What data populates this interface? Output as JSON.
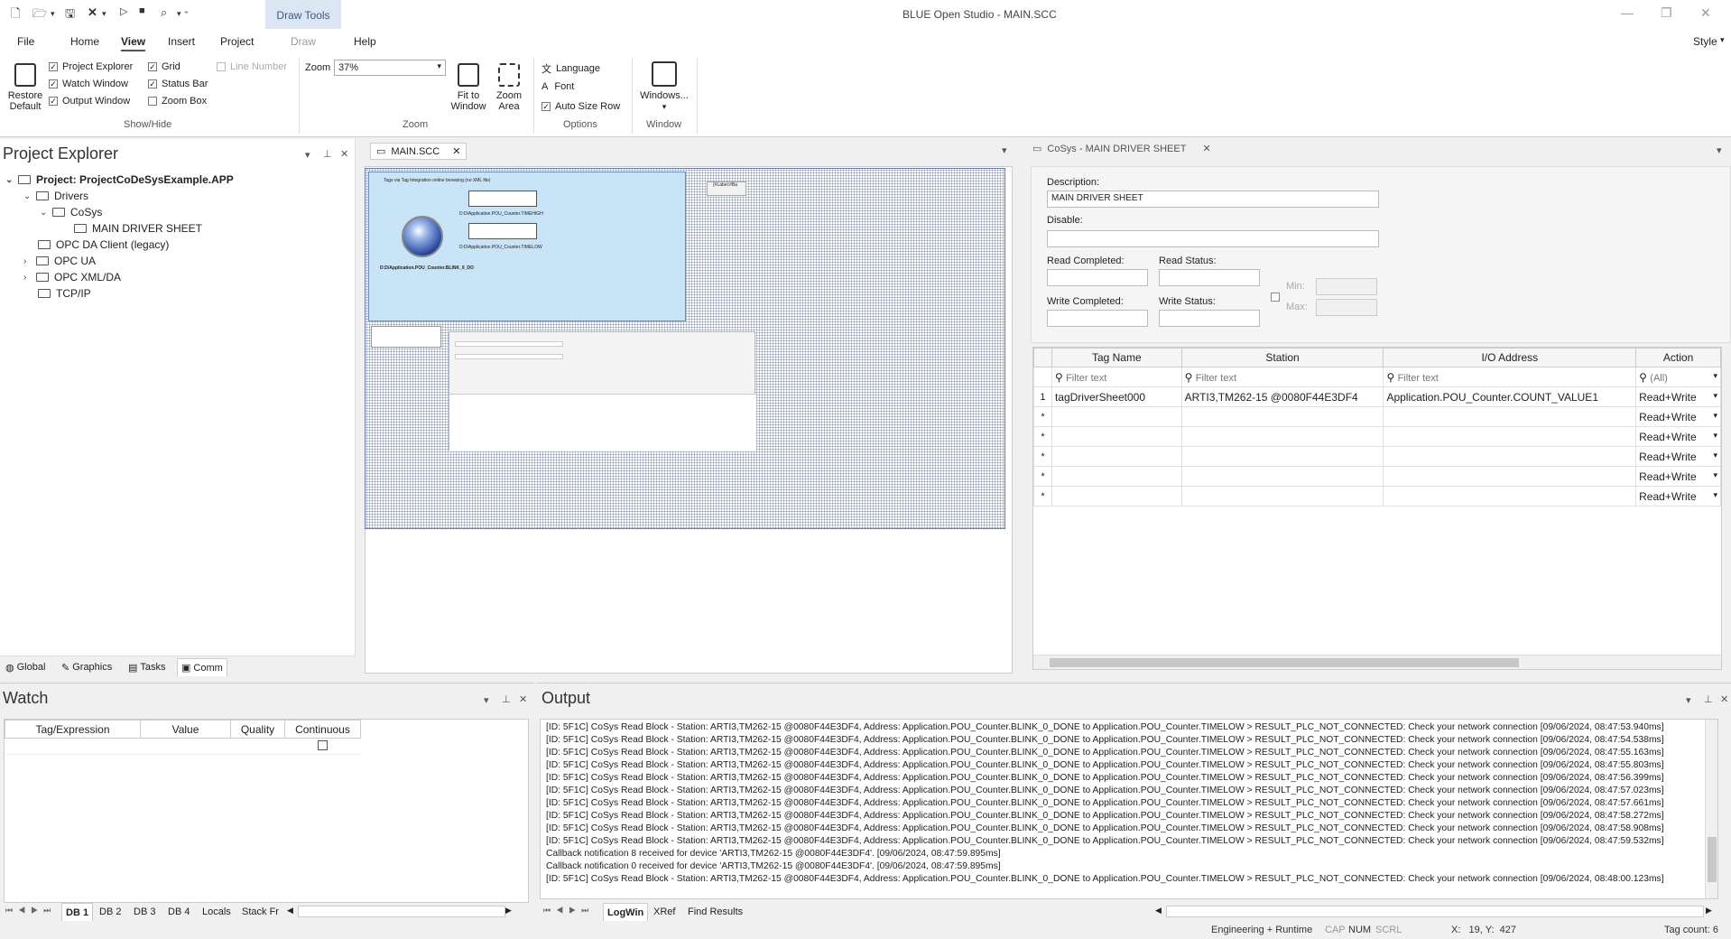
{
  "app": {
    "window_title": "BLUE Open Studio - MAIN.SCC",
    "context_tab": "Draw Tools"
  },
  "menu": {
    "items": [
      "File",
      "Home",
      "View",
      "Insert",
      "Project",
      "Draw",
      "Help"
    ],
    "style_label": "Style"
  },
  "ribbon": {
    "restore_default": "Restore Default",
    "restore_default_l1": "Restore",
    "restore_default_l2": "Default",
    "project_explorer": "Project Explorer",
    "watch_window": "Watch Window",
    "output_window": "Output Window",
    "grid": "Grid",
    "status_bar": "Status Bar",
    "zoom_box": "Zoom Box",
    "line_number": "Line Number",
    "show_hide_label": "Show/Hide",
    "zoom_label": "Zoom",
    "zoom_value": "37%",
    "fit_to_window_l1": "Fit to",
    "fit_to_window_l2": "Window",
    "zoom_area_l1": "Zoom",
    "zoom_area_l2": "Area",
    "zoom_group_label": "Zoom",
    "language": "Language",
    "font": "Font",
    "auto_size_row": "Auto Size Row",
    "options_label": "Options",
    "windows": "Windows...",
    "window_label": "Window"
  },
  "project_explorer": {
    "title": "Project Explorer",
    "project": "Project: ProjectCoDeSysExample.APP",
    "drivers": "Drivers",
    "cosys": "CoSys",
    "main_driver_sheet": "MAIN DRIVER SHEET",
    "opc_da": "OPC DA Client (legacy)",
    "opc_ua": "OPC UA",
    "opc_xml": "OPC XML/DA",
    "tcpip": "TCP/IP",
    "tabs": [
      "Global",
      "Graphics",
      "Tasks",
      "Comm"
    ]
  },
  "screen_doc": {
    "tab_label": "MAIN.SCC",
    "canvas_caption": "Tags via Tag Integration online browsing (no XML file)",
    "tag1": "D:D/Application.POU_Counter.TIMEHIGH",
    "tag2": "D:D/Application.POU_Counter.TIMELOW",
    "tag3": "D:D/Application.POU_Counter.BLINK_0_DO",
    "label_box": "{#Label:#Ba"
  },
  "driver_sheet": {
    "tab_label": "CoSys - MAIN DRIVER SHEET",
    "description_label": "Description:",
    "description_value": "MAIN DRIVER SHEET",
    "disable_label": "Disable:",
    "read_completed_label": "Read Completed:",
    "read_status_label": "Read Status:",
    "write_completed_label": "Write Completed:",
    "write_status_label": "Write Status:",
    "min_label": "Min:",
    "max_label": "Max:",
    "columns": [
      "Tag Name",
      "Station",
      "I/O Address",
      "Action"
    ],
    "filter_text": "Filter text",
    "action_filter": "(All)",
    "rows": [
      {
        "num": "1",
        "tag": "tagDriverSheet000",
        "station": "ARTI3,TM262-15 @0080F44E3DF4",
        "address": "Application.POU_Counter.COUNT_VALUE1",
        "action": "Read+Write"
      },
      {
        "num": "*",
        "tag": "",
        "station": "",
        "address": "",
        "action": "Read+Write"
      },
      {
        "num": "*",
        "tag": "",
        "station": "",
        "address": "",
        "action": "Read+Write"
      },
      {
        "num": "*",
        "tag": "",
        "station": "",
        "address": "",
        "action": "Read+Write"
      },
      {
        "num": "*",
        "tag": "",
        "station": "",
        "address": "",
        "action": "Read+Write"
      },
      {
        "num": "*",
        "tag": "",
        "station": "",
        "address": "",
        "action": "Read+Write"
      }
    ]
  },
  "watch": {
    "title": "Watch",
    "columns": [
      "Tag/Expression",
      "Value",
      "Quality",
      "Continuous"
    ],
    "tabs": [
      "DB 1",
      "DB 2",
      "DB 3",
      "DB 4",
      "Locals",
      "Stack Fr"
    ]
  },
  "output": {
    "title": "Output",
    "lines": [
      "[ID: 5F1C] CoSys Read Block - Station: ARTI3,TM262-15 @0080F44E3DF4, Address: Application.POU_Counter.BLINK_0_DONE to Application.POU_Counter.TIMELOW > RESULT_PLC_NOT_CONNECTED: Check your network connection [09/06/2024, 08:47:53.940ms]",
      "[ID: 5F1C] CoSys Read Block - Station: ARTI3,TM262-15 @0080F44E3DF4, Address: Application.POU_Counter.BLINK_0_DONE to Application.POU_Counter.TIMELOW > RESULT_PLC_NOT_CONNECTED: Check your network connection [09/06/2024, 08:47:54.538ms]",
      "[ID: 5F1C] CoSys Read Block - Station: ARTI3,TM262-15 @0080F44E3DF4, Address: Application.POU_Counter.BLINK_0_DONE to Application.POU_Counter.TIMELOW > RESULT_PLC_NOT_CONNECTED: Check your network connection [09/06/2024, 08:47:55.163ms]",
      "[ID: 5F1C] CoSys Read Block - Station: ARTI3,TM262-15 @0080F44E3DF4, Address: Application.POU_Counter.BLINK_0_DONE to Application.POU_Counter.TIMELOW > RESULT_PLC_NOT_CONNECTED: Check your network connection [09/06/2024, 08:47:55.803ms]",
      "[ID: 5F1C] CoSys Read Block - Station: ARTI3,TM262-15 @0080F44E3DF4, Address: Application.POU_Counter.BLINK_0_DONE to Application.POU_Counter.TIMELOW > RESULT_PLC_NOT_CONNECTED: Check your network connection [09/06/2024, 08:47:56.399ms]",
      "[ID: 5F1C] CoSys Read Block - Station: ARTI3,TM262-15 @0080F44E3DF4, Address: Application.POU_Counter.BLINK_0_DONE to Application.POU_Counter.TIMELOW > RESULT_PLC_NOT_CONNECTED: Check your network connection [09/06/2024, 08:47:57.023ms]",
      "[ID: 5F1C] CoSys Read Block - Station: ARTI3,TM262-15 @0080F44E3DF4, Address: Application.POU_Counter.BLINK_0_DONE to Application.POU_Counter.TIMELOW > RESULT_PLC_NOT_CONNECTED: Check your network connection [09/06/2024, 08:47:57.661ms]",
      "[ID: 5F1C] CoSys Read Block - Station: ARTI3,TM262-15 @0080F44E3DF4, Address: Application.POU_Counter.BLINK_0_DONE to Application.POU_Counter.TIMELOW > RESULT_PLC_NOT_CONNECTED: Check your network connection [09/06/2024, 08:47:58.272ms]",
      "[ID: 5F1C] CoSys Read Block - Station: ARTI3,TM262-15 @0080F44E3DF4, Address: Application.POU_Counter.BLINK_0_DONE to Application.POU_Counter.TIMELOW > RESULT_PLC_NOT_CONNECTED: Check your network connection [09/06/2024, 08:47:58.908ms]",
      "[ID: 5F1C] CoSys Read Block - Station: ARTI3,TM262-15 @0080F44E3DF4, Address: Application.POU_Counter.BLINK_0_DONE to Application.POU_Counter.TIMELOW > RESULT_PLC_NOT_CONNECTED: Check your network connection [09/06/2024, 08:47:59.532ms]",
      "Callback notification 8 received for device 'ARTI3,TM262-15 @0080F44E3DF4'. [09/06/2024, 08:47:59.895ms]",
      "Callback notification 0 received for device 'ARTI3,TM262-15 @0080F44E3DF4'. [09/06/2024, 08:47:59.895ms]",
      "[ID: 5F1C] CoSys Read Block - Station: ARTI3,TM262-15 @0080F44E3DF4, Address: Application.POU_Counter.BLINK_0_DONE to Application.POU_Counter.TIMELOW > RESULT_PLC_NOT_CONNECTED: Check your network connection [09/06/2024, 08:48:00.123ms]"
    ],
    "tabs": [
      "LogWin",
      "XRef",
      "Find Results"
    ]
  },
  "statusbar": {
    "mode": "Engineering + Runtime",
    "cap": "CAP",
    "num": "NUM",
    "scrl": "SCRL",
    "coords": "X:   19, Y:  427",
    "tag_count": "Tag count: 6"
  }
}
